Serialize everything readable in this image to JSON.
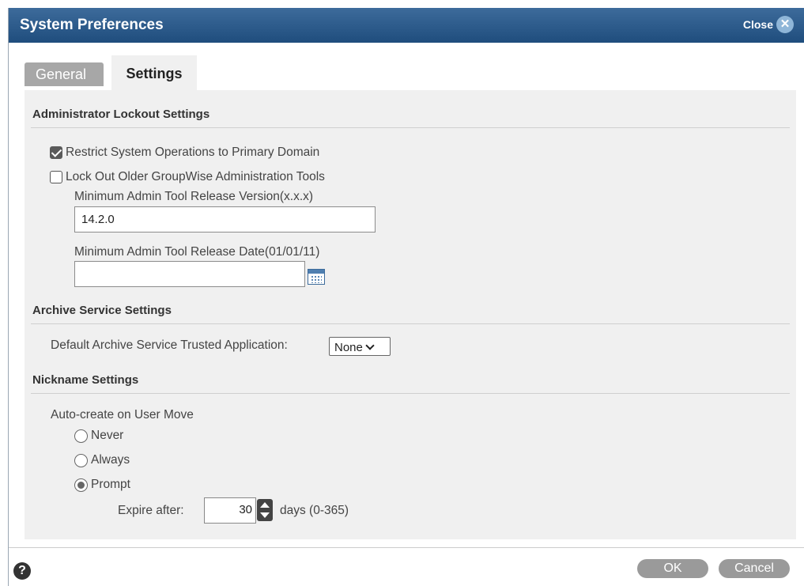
{
  "window": {
    "title": "System Preferences",
    "close_label": "Close",
    "close_icon": "x-circle-icon"
  },
  "tabs": [
    {
      "label": "General",
      "active": false
    },
    {
      "label": "Settings",
      "active": true
    }
  ],
  "admin_lockout": {
    "title": "Administrator Lockout Settings",
    "restrict_label": "Restrict System Operations to Primary Domain",
    "restrict_checked": true,
    "lockout_label": "Lock Out Older GroupWise Administration Tools",
    "lockout_checked": false,
    "min_version_label": "Minimum Admin Tool Release Version(x.x.x)",
    "min_version_value": "14.2.0",
    "min_date_label": "Minimum Admin Tool Release Date(01/01/11)",
    "min_date_value": ""
  },
  "archive": {
    "title": "Archive Service Settings",
    "trusted_app_label": "Default Archive Service Trusted Application:",
    "trusted_app_value": "None"
  },
  "nickname": {
    "title": "Nickname Settings",
    "auto_create_label": "Auto-create on User Move",
    "options": [
      {
        "label": "Never",
        "selected": false
      },
      {
        "label": "Always",
        "selected": false
      },
      {
        "label": "Prompt",
        "selected": true
      }
    ],
    "expire_label": "Expire after:",
    "expire_value": "30",
    "expire_unit": "days (0-365)"
  },
  "footer": {
    "help_icon": "question-circle-icon",
    "ok_label": "OK",
    "cancel_label": "Cancel"
  },
  "colors": {
    "titlebar": "#2a5887",
    "panel_bg": "#f0f0f0",
    "button_bg": "#9a9a9a"
  }
}
